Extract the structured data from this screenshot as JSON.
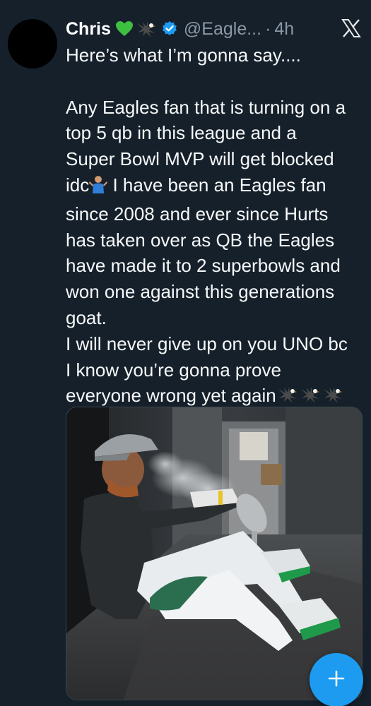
{
  "tweet": {
    "author_name": "Chris",
    "author_emojis": [
      "green-heart-icon",
      "eagle-icon"
    ],
    "verified": true,
    "handle": "@Eagle...",
    "separator": "·",
    "time": "4h",
    "text_lines": [
      "Here’s what I’m gonna say....",
      "",
      "Any Eagles fan that is turning on a",
      "top 5 qb in this league and a",
      "Super Bowl MVP will get blocked",
      "idc",
      " I have been an Eagles fan",
      "since 2008 and ever since Hurts",
      "has taken over as QB the Eagles",
      "have made it to 2 superbowls and",
      "won one against this generations",
      "goat.",
      "I will never give up on you UNO bc",
      "I know you’re gonna prove",
      "everyone wrong yet again"
    ]
  },
  "colors": {
    "background": "#15202b",
    "text": "#f7f9f9",
    "secondary_text": "#8b98a5",
    "accent": "#1d9bf0",
    "heart": "#3fbf3f"
  },
  "icons": {
    "verified": "verified-badge-icon",
    "close": "x-logo-icon",
    "fab": "plus-icon"
  }
}
